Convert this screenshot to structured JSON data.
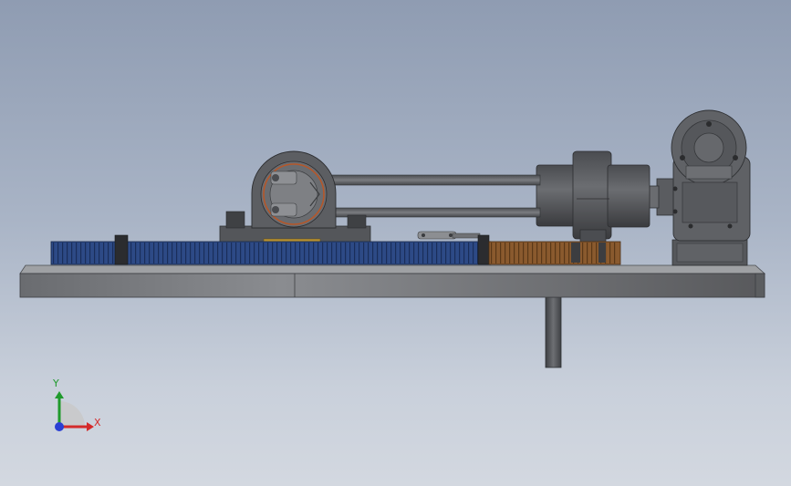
{
  "view": {
    "background_top": "#8f9cb2",
    "background_bottom": "#d3d8e0"
  },
  "model": {
    "parts": [
      "base-plate",
      "support-post",
      "blue-gear-rack",
      "orange-gear",
      "bearing-housing",
      "connecting-rods",
      "cylinder",
      "worm-gearbox",
      "motor-stand",
      "small-linkage"
    ],
    "colors": {
      "steel": "#5d5f63",
      "steel_dark": "#3e4044",
      "plate": "#6f7174",
      "rack": "#2d4a86",
      "gear": "#8a5a2e"
    }
  },
  "triad": {
    "x_label": "X",
    "y_label": "Y",
    "x_color": "#d42a2a",
    "y_color": "#1f9a2c",
    "z_color": "#2a3fd4"
  }
}
